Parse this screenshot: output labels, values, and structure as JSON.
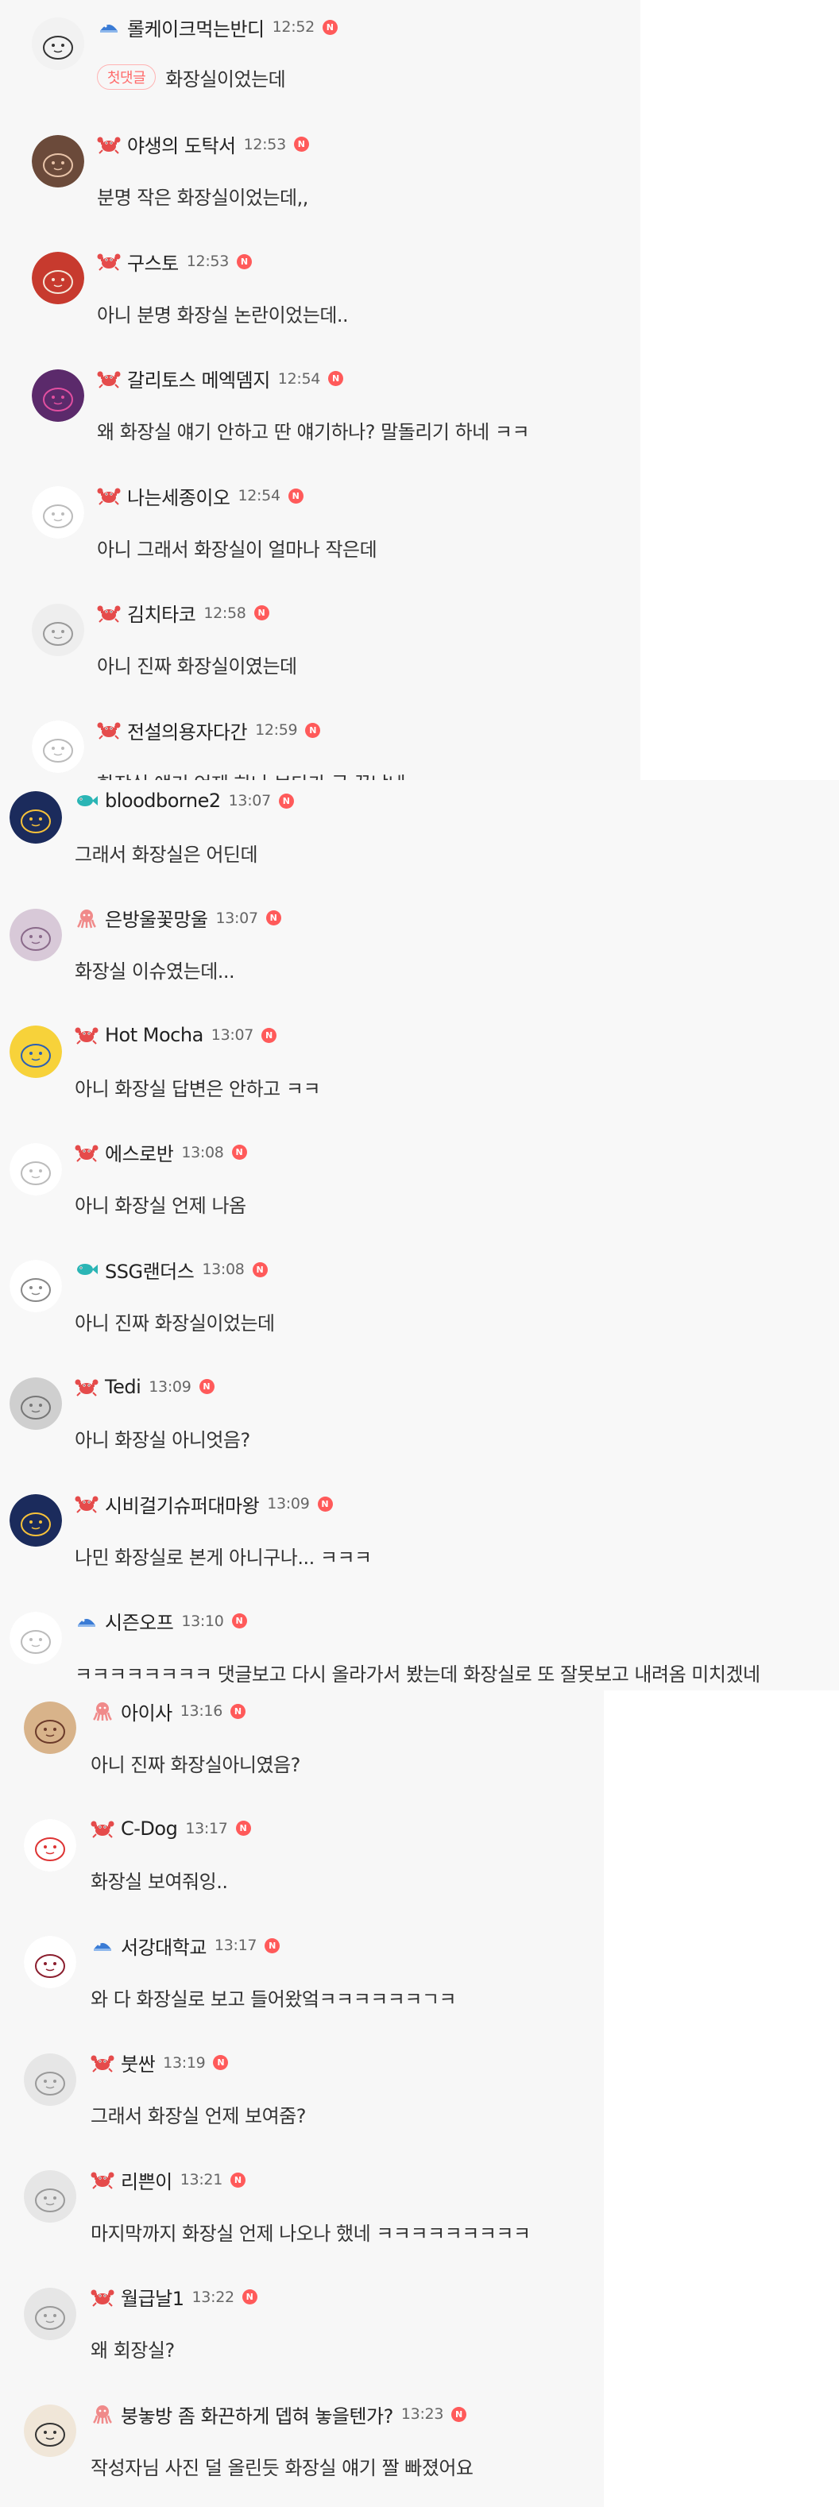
{
  "colors": {
    "section1_bg": "#f7f7f7",
    "section2_bg": "#f8f8f8",
    "section3_bg": "#f7f7f7",
    "new_badge": "#ff5a5a",
    "first_comment_badge": "#ff6b6b"
  },
  "sections": [
    {
      "comments": [
        {
          "level_icon": "fish-blue-icon",
          "nick": "롤케이크먹는반디",
          "time": "12:52",
          "badge": "첫댓글",
          "text": "화장실이었는데"
        },
        {
          "level_icon": "crab-red-icon",
          "nick": "야생의 도탁서",
          "time": "12:53",
          "text": "분명 작은 화장실이었는데,,"
        },
        {
          "level_icon": "crab-red-icon",
          "nick": "구스토",
          "time": "12:53",
          "text": "아니 분명 화장실 논란이었는데.."
        },
        {
          "level_icon": "crab-red-icon",
          "nick": "갈리토스 메엑뎀지",
          "time": "12:54",
          "text": "왜 화장실 얘기 안하고 딴 얘기하나? 말돌리기 하네 ㅋㅋ"
        },
        {
          "level_icon": "crab-red-icon",
          "nick": "나는세종이오",
          "time": "12:54",
          "text": "아니 그래서 화장실이 얼마나 작은데"
        },
        {
          "level_icon": "crab-red-icon",
          "nick": "김치타코",
          "time": "12:58",
          "text": "아니 진짜 화장실이였는데"
        },
        {
          "level_icon": "crab-red-icon",
          "nick": "전설의용자다간",
          "time": "12:59",
          "text": "화장실 얘기 언제 하나 보다가 글 끝났네;;"
        }
      ]
    },
    {
      "comments": [
        {
          "level_icon": "fish-teal-icon",
          "nick": "bloodborne2",
          "time": "13:07",
          "text": "그래서 화장실은 어딘데"
        },
        {
          "level_icon": "octopus-pink-icon",
          "nick": "은방울꽃망울",
          "time": "13:07",
          "text": "화장실 이슈였는데..."
        },
        {
          "level_icon": "crab-red-icon",
          "nick": "Hot Mocha",
          "time": "13:07",
          "text": "아니 화장실 답변은 안하고 ㅋㅋ"
        },
        {
          "level_icon": "crab-red-icon",
          "nick": "에스로반",
          "time": "13:08",
          "text": "아니 화장실 언제 나옴"
        },
        {
          "level_icon": "fish-teal-icon",
          "nick": "SSG랜더스",
          "time": "13:08",
          "text": "아니 진짜 화장실이었는데"
        },
        {
          "level_icon": "crab-red-icon",
          "nick": "Tedi",
          "time": "13:09",
          "text": "아니 화장실 아니엇음?"
        },
        {
          "level_icon": "crab-red-icon",
          "nick": "시비걸기슈퍼대마왕",
          "time": "13:09",
          "text": "나민 화장실로 본게 아니구나... ㅋㅋㅋ"
        },
        {
          "level_icon": "fish-blue-icon",
          "nick": "시즌오프",
          "time": "13:10",
          "text": "ㅋㅋㅋㅋㅋㅋㅋㅋ 댓글보고 다시 올라가서 봤는데 화장실로 또 잘못보고 내려옴 미치겠네"
        }
      ]
    },
    {
      "comments": [
        {
          "level_icon": "octopus-pink-icon",
          "nick": "아이사",
          "time": "13:16",
          "text": "아니 진짜 화장실아니였음?"
        },
        {
          "level_icon": "crab-red-icon",
          "nick": "C-Dog",
          "time": "13:17",
          "text": "화장실 보여줘잉.."
        },
        {
          "level_icon": "fish-blue-icon",
          "nick": "서강대학교",
          "time": "13:17",
          "text": "와 다 화장실로 보고 들어왔엌ㅋㅋㅋㅋㅋㅋㄱㅋ"
        },
        {
          "level_icon": "crab-red-icon",
          "nick": "붓싼",
          "time": "13:19",
          "text": "그래서 화장실 언제 보여줌?"
        },
        {
          "level_icon": "crab-red-icon",
          "nick": "리쁜이",
          "time": "13:21",
          "text": "마지막까지 화장실 언제 나오나 했네 ㅋㅋㅋㅋㅋㅋㅋㅋㅋ"
        },
        {
          "level_icon": "crab-red-icon",
          "nick": "월급날1",
          "time": "13:22",
          "text": "왜 회장실?"
        },
        {
          "level_icon": "octopus-pink-icon",
          "nick": "붕놓방 좀 화끈하게 뎁혀 놓을텐가?",
          "time": "13:23",
          "text": "작성자님 사진 덜 올린듯 화장실 얘기 짤 빠졌어요"
        }
      ]
    }
  ]
}
